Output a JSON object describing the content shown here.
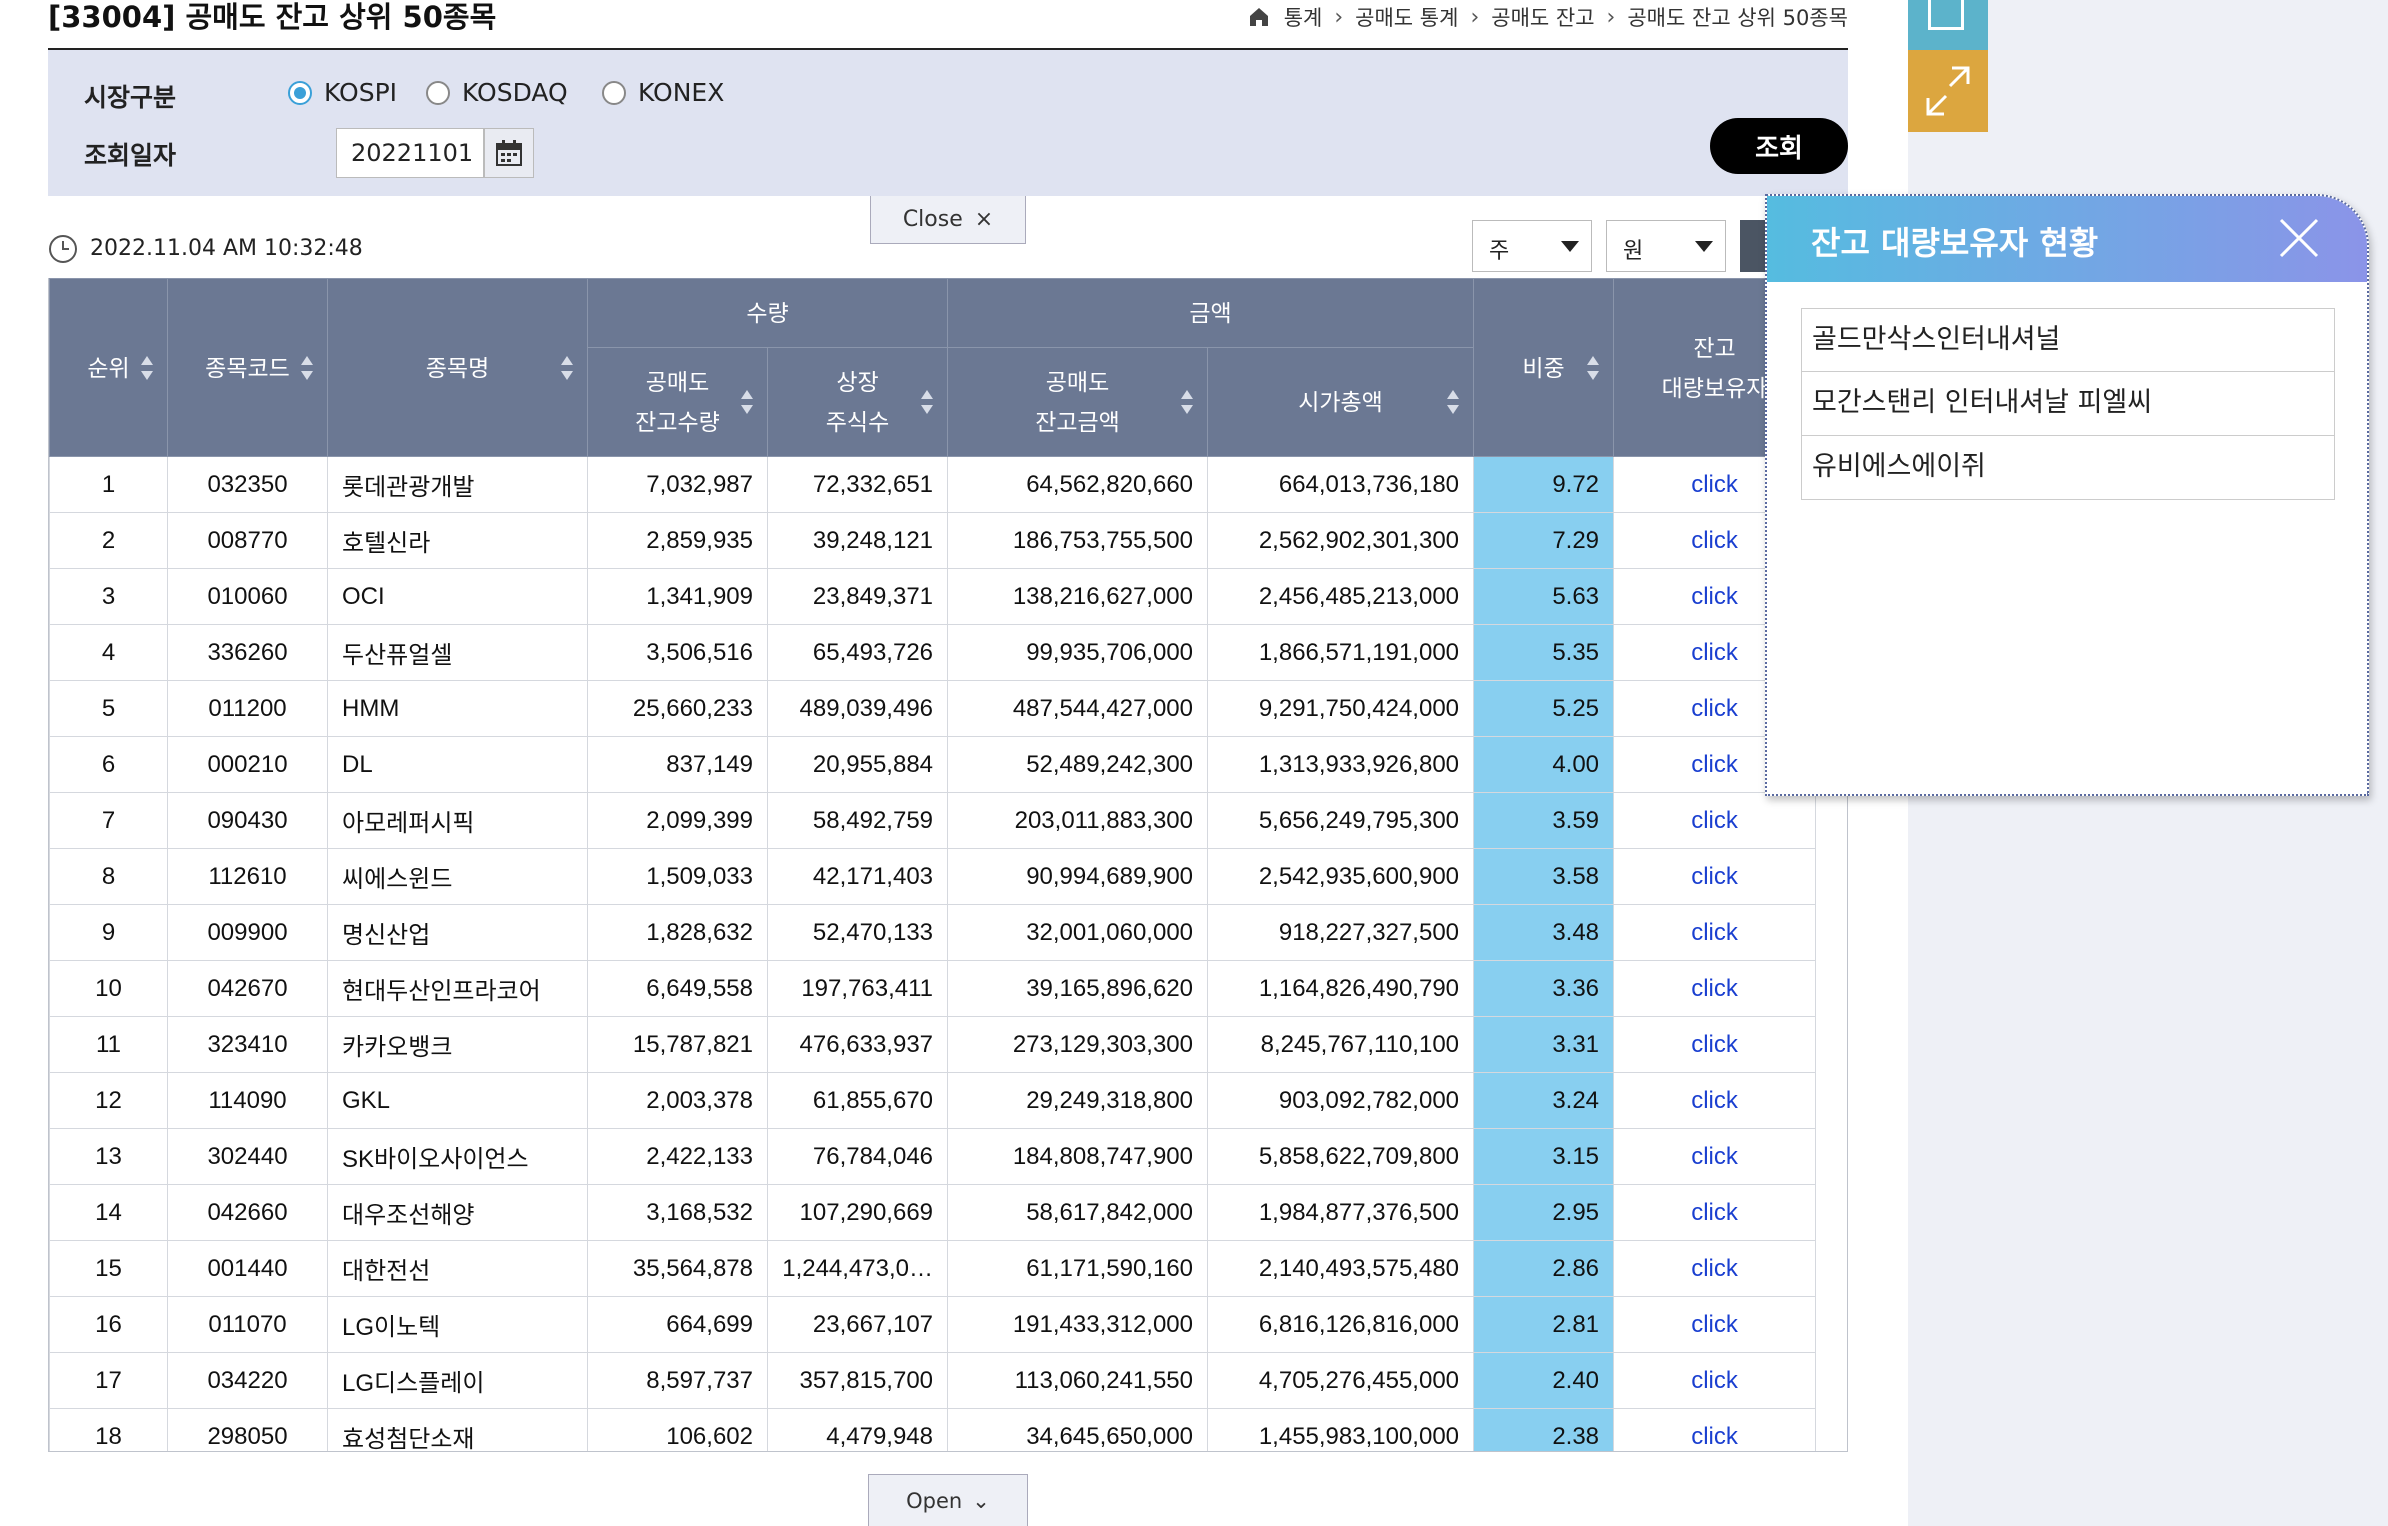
{
  "header": {
    "title": "[33004] 공매도 잔고 상위 50종목",
    "breadcrumb": [
      "통계",
      "공매도 통계",
      "공매도 잔고",
      "공매도 잔고 상위 50종목"
    ]
  },
  "search": {
    "market_label": "시장구분",
    "market_options": [
      "KOSPI",
      "KOSDAQ",
      "KONEX"
    ],
    "market_selected": "KOSPI",
    "date_label": "조회일자",
    "date_value": "20221101",
    "search_button": "조회"
  },
  "toggles": {
    "close_label": "Close",
    "open_label": "Open"
  },
  "timestamp": "2022.11.04 AM 10:32:48",
  "unit_selects": {
    "quantity_unit": "주",
    "amount_unit": "원"
  },
  "table": {
    "groups": {
      "quantity": "수량",
      "amount": "금액"
    },
    "columns": {
      "rank": "순위",
      "code": "종목코드",
      "name": "종목명",
      "short_qty_1": "공매도",
      "short_qty_2": "잔고수량",
      "listed_1": "상장",
      "listed_2": "주식수",
      "short_amt_1": "공매도",
      "short_amt_2": "잔고금액",
      "mktcap": "시가총액",
      "ratio": "비중",
      "holder_1": "잔고",
      "holder_2": "대량보유자"
    },
    "rows": [
      [
        "1",
        "032350",
        "롯데관광개발",
        "7,032,987",
        "72,332,651",
        "64,562,820,660",
        "664,013,736,180",
        "9.72",
        "click"
      ],
      [
        "2",
        "008770",
        "호텔신라",
        "2,859,935",
        "39,248,121",
        "186,753,755,500",
        "2,562,902,301,300",
        "7.29",
        "click"
      ],
      [
        "3",
        "010060",
        "OCI",
        "1,341,909",
        "23,849,371",
        "138,216,627,000",
        "2,456,485,213,000",
        "5.63",
        "click"
      ],
      [
        "4",
        "336260",
        "두산퓨얼셀",
        "3,506,516",
        "65,493,726",
        "99,935,706,000",
        "1,866,571,191,000",
        "5.35",
        "click"
      ],
      [
        "5",
        "011200",
        "HMM",
        "25,660,233",
        "489,039,496",
        "487,544,427,000",
        "9,291,750,424,000",
        "5.25",
        "click"
      ],
      [
        "6",
        "000210",
        "DL",
        "837,149",
        "20,955,884",
        "52,489,242,300",
        "1,313,933,926,800",
        "4.00",
        "click"
      ],
      [
        "7",
        "090430",
        "아모레퍼시픽",
        "2,099,399",
        "58,492,759",
        "203,011,883,300",
        "5,656,249,795,300",
        "3.59",
        "click"
      ],
      [
        "8",
        "112610",
        "씨에스윈드",
        "1,509,033",
        "42,171,403",
        "90,994,689,900",
        "2,542,935,600,900",
        "3.58",
        "click"
      ],
      [
        "9",
        "009900",
        "명신산업",
        "1,828,632",
        "52,470,133",
        "32,001,060,000",
        "918,227,327,500",
        "3.48",
        "click"
      ],
      [
        "10",
        "042670",
        "현대두산인프라코어",
        "6,649,558",
        "197,763,411",
        "39,165,896,620",
        "1,164,826,490,790",
        "3.36",
        "click"
      ],
      [
        "11",
        "323410",
        "카카오뱅크",
        "15,787,821",
        "476,633,937",
        "273,129,303,300",
        "8,245,767,110,100",
        "3.31",
        "click"
      ],
      [
        "12",
        "114090",
        "GKL",
        "2,003,378",
        "61,855,670",
        "29,249,318,800",
        "903,092,782,000",
        "3.24",
        "click"
      ],
      [
        "13",
        "302440",
        "SK바이오사이언스",
        "2,422,133",
        "76,784,046",
        "184,808,747,900",
        "5,858,622,709,800",
        "3.15",
        "click"
      ],
      [
        "14",
        "042660",
        "대우조선해양",
        "3,168,532",
        "107,290,669",
        "58,617,842,000",
        "1,984,877,376,500",
        "2.95",
        "click"
      ],
      [
        "15",
        "001440",
        "대한전선",
        "35,564,878",
        "1,244,473,0…",
        "61,171,590,160",
        "2,140,493,575,480",
        "2.86",
        "click"
      ],
      [
        "16",
        "011070",
        "LG이노텍",
        "664,699",
        "23,667,107",
        "191,433,312,000",
        "6,816,126,816,000",
        "2.81",
        "click"
      ],
      [
        "17",
        "034220",
        "LG디스플레이",
        "8,597,737",
        "357,815,700",
        "113,060,241,550",
        "4,705,276,455,000",
        "2.40",
        "click"
      ],
      [
        "18",
        "298050",
        "효성첨단소재",
        "106,602",
        "4,479,948",
        "34,645,650,000",
        "1,455,983,100,000",
        "2.38",
        "click"
      ]
    ]
  },
  "popup": {
    "title": "잔고 대량보유자 현황",
    "holders": [
      "골드만삭스인터내셔널",
      "모간스탠리 인터내셔날 피엘씨",
      "유비에스에이쥐"
    ]
  },
  "colors": {
    "header_bg": "#6b7893",
    "ratio_bg": "#88cff0",
    "link": "#1a3fd0",
    "search_panel_bg": "#dfe3f1",
    "popup_gradient_start": "#55bce0",
    "popup_gradient_end": "#8b94e8"
  },
  "icons": [
    "home-icon",
    "chevron-right-icon",
    "calendar-icon",
    "clock-icon",
    "close-icon",
    "chevron-down-icon",
    "filter-icon",
    "expand-icon"
  ]
}
